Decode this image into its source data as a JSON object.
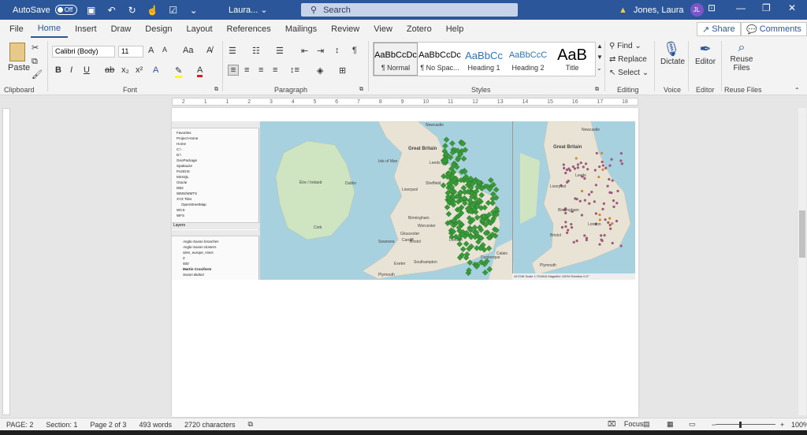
{
  "titlebar": {
    "autosave_label": "AutoSave",
    "autosave_state": "Off",
    "doc_name": "Laura...",
    "search_placeholder": "Search",
    "warning_icon": "warning-icon",
    "user_name": "Jones, Laura",
    "user_initials": "JL"
  },
  "tabs": [
    "File",
    "Home",
    "Insert",
    "Draw",
    "Design",
    "Layout",
    "References",
    "Mailings",
    "Review",
    "View",
    "Zotero",
    "Help"
  ],
  "active_tab": "Home",
  "share_label": "Share",
  "comments_label": "Comments",
  "ribbon": {
    "clipboard": {
      "paste_label": "Paste",
      "group_label": "Clipboard"
    },
    "font": {
      "font_name": "Calibri (Body)",
      "font_size": "11",
      "group_label": "Font"
    },
    "paragraph": {
      "group_label": "Paragraph"
    },
    "styles": {
      "group_label": "Styles",
      "items": [
        {
          "preview": "AaBbCcDc",
          "name": "¶ Normal"
        },
        {
          "preview": "AaBbCcDc",
          "name": "¶ No Spac..."
        },
        {
          "preview": "AaBbCc",
          "name": "Heading 1"
        },
        {
          "preview": "AaBbCcC",
          "name": "Heading 2"
        },
        {
          "preview": "AaB",
          "name": "Title"
        }
      ]
    },
    "editing": {
      "find": "Find",
      "replace": "Replace",
      "select": "Select",
      "group_label": "Editing"
    },
    "voice": {
      "dictate": "Dictate",
      "group_label": "Voice"
    },
    "editor": {
      "editor": "Editor",
      "group_label": "Editor"
    },
    "reuse": {
      "reuse_line1": "Reuse",
      "reuse_line2": "Files",
      "group_label": "Reuse Files"
    }
  },
  "ruler_numbers": [
    "2",
    "1",
    "1",
    "2",
    "3",
    "4",
    "5",
    "6",
    "7",
    "8",
    "9",
    "10",
    "11",
    "12",
    "13",
    "14",
    "15",
    "16",
    "17",
    "18"
  ],
  "qgis": {
    "browser_items": [
      "Favorites",
      "Project Home",
      "Home",
      "C:\\",
      "D:\\",
      "GeoPackage",
      "SpatiaLite",
      "PostGIS",
      "MSSQL",
      "Oracle",
      "DB2",
      "WMS/WMTS",
      "XYZ Tiles",
      "OpenStreetMap",
      "WCS",
      "WFS"
    ],
    "layers_title": "Layers",
    "layers": [
      "Anglo-Saxon brooches",
      "Anglo-Saxon clusters",
      "sites_europe_Hans",
      "0",
      "500",
      "Martin Cruciform",
      "Saxon Button"
    ],
    "map_labels_left": [
      "Great Britain",
      "Isle of Man",
      "Éire / Ireland",
      "Dublin",
      "Cork",
      "Liverpool",
      "Sheffield",
      "Birmingham",
      "Cardiff",
      "Swansea",
      "London",
      "Southampton",
      "Exeter",
      "Plymouth",
      "Newcastle",
      "Leeds",
      "Gloucester",
      "Worcester",
      "Bristol",
      "Dunkerque",
      "Calais"
    ],
    "map_labels_right": [
      "Great Britain",
      "Leeds",
      "Liverpool",
      "Birmingham",
      "London",
      "Plymouth",
      "Bristol",
      "Newcastle"
    ],
    "statusline": "447248  Scale 1:704616  Magnifier 100%  Rotation 0.0°"
  },
  "statusbar": {
    "page": "PAGE: 2",
    "section": "Section: 1",
    "page_of": "Page 2 of 3",
    "words": "493 words",
    "characters": "2720 characters",
    "focus": "Focus",
    "zoom": "100%"
  },
  "colors": {
    "title_blue": "#2b579a",
    "green_points": "#3a9a3a",
    "mauve_points": "#9b5a7a"
  }
}
